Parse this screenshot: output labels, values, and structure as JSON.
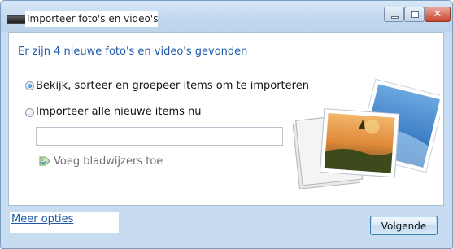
{
  "window": {
    "title": "Importeer foto's en video's",
    "buttons": {
      "close_glyph": "✕"
    }
  },
  "content": {
    "heading": "Er zijn 4 nieuwe foto's en video's gevonden",
    "options": [
      {
        "label": "Bekijk, sorteer en groepeer items om te importeren",
        "selected": true
      },
      {
        "label": "Importeer alle nieuwe items nu",
        "selected": false
      }
    ],
    "tag_field": {
      "value": "",
      "placeholder": ""
    },
    "bookmark_label": "Voeg bladwijzers toe"
  },
  "footer": {
    "more_options": "Meer opties",
    "next_button": "Volgende"
  },
  "colors": {
    "heading": "#1e5aa8",
    "link": "#1e5aa8",
    "frame": "#c7dcf1"
  }
}
